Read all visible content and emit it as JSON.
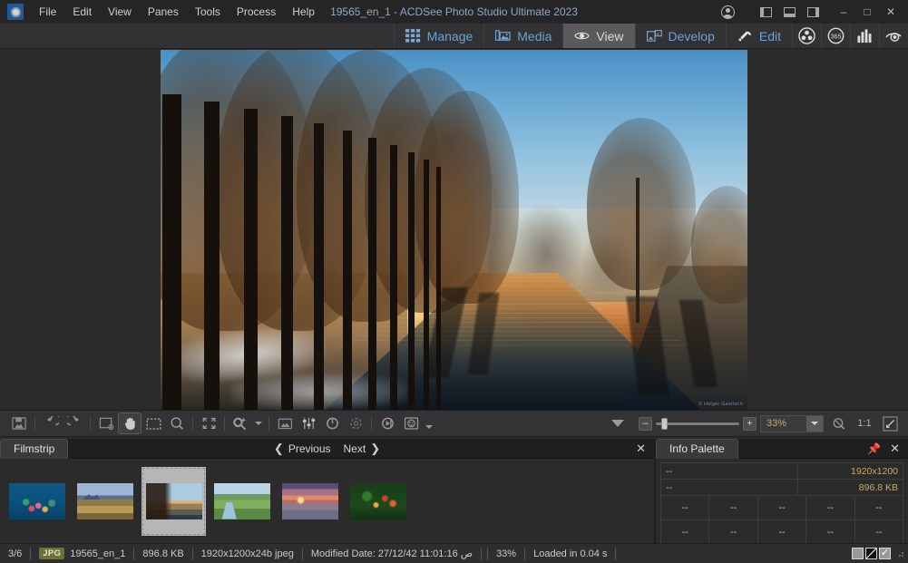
{
  "window": {
    "title": "19565_en_1 - ACDSee Photo Studio Ultimate 2023",
    "app_icon": "acdsee-logo-icon",
    "minimize": "–",
    "maximize": "□",
    "close": "✕"
  },
  "menu": {
    "items": [
      {
        "label": "File"
      },
      {
        "label": "Edit"
      },
      {
        "label": "View"
      },
      {
        "label": "Panes"
      },
      {
        "label": "Tools"
      },
      {
        "label": "Process"
      },
      {
        "label": "Help"
      }
    ]
  },
  "title_right": {
    "account_icon": "person-icon",
    "pane_left_icon": "pane-left-icon",
    "pane_bottom_icon": "pane-bottom-icon",
    "pane_right_icon": "pane-right-icon"
  },
  "modebar": {
    "tabs": [
      {
        "label": "Manage",
        "icon": "grid-icon",
        "active": false
      },
      {
        "label": "Media",
        "icon": "media-stack-icon",
        "active": false
      },
      {
        "label": "View",
        "icon": "eye-icon",
        "active": true
      },
      {
        "label": "Develop",
        "icon": "develop-icon",
        "active": false
      },
      {
        "label": "Edit",
        "icon": "brush-pencil-icon",
        "active": false
      }
    ],
    "extra_icons": [
      {
        "name": "people-icon"
      },
      {
        "name": "365-icon",
        "label": "365"
      },
      {
        "name": "histogram-icon"
      },
      {
        "name": "eye-dropper-icon"
      }
    ]
  },
  "viewer": {
    "image_alt": "Frozen canal lined with bare trees at sunrise",
    "watermark": "© Holger Gaertsch"
  },
  "view_toolbar": {
    "tools": [
      {
        "name": "save-image-icon"
      },
      {
        "name": "rotate-left-icon"
      },
      {
        "name": "rotate-right-icon"
      },
      {
        "name": "fit-image-icon"
      },
      {
        "name": "pan-hand-icon",
        "selected": true
      },
      {
        "name": "select-region-icon"
      },
      {
        "name": "magnifier-icon"
      },
      {
        "name": "fullscreen-icon"
      },
      {
        "name": "auto-edit-icon"
      },
      {
        "name": "auto-edit-dropdown-icon"
      },
      {
        "name": "filmstrip-toggle-icon"
      },
      {
        "name": "adjust-sliders-icon"
      },
      {
        "name": "exposure-dial-icon"
      },
      {
        "name": "refresh-icon"
      },
      {
        "name": "slideshow-play-icon"
      },
      {
        "name": "face-detect-icon"
      },
      {
        "name": "more-dropdown-icon"
      }
    ],
    "zoom": {
      "collapse_icon": "collapse-caret-icon",
      "minus": "–",
      "plus": "+",
      "value": "33%",
      "dropdown_icon": "chevron-down-icon",
      "zoom_reset_icon": "zoom-reset-icon",
      "one_to_one": "1:1",
      "fit_icon": "fit-to-window-icon"
    }
  },
  "filmstrip": {
    "tab_label": "Filmstrip",
    "previous_label": "Previous",
    "next_label": "Next",
    "prev_icon": "chevron-left-icon",
    "next_icon": "chevron-right-icon",
    "close_icon": "close-icon",
    "thumbnails": [
      {
        "name": "thumb-coral-reef",
        "selected": false
      },
      {
        "name": "thumb-mountain-field",
        "selected": false
      },
      {
        "name": "thumb-frozen-canal",
        "selected": true
      },
      {
        "name": "thumb-green-meadow",
        "selected": false
      },
      {
        "name": "thumb-sunset-sea",
        "selected": false
      },
      {
        "name": "thumb-autumn-berries",
        "selected": false
      }
    ]
  },
  "info_palette": {
    "tab_label": "Info Palette",
    "pin_icon": "pin-icon",
    "close_icon": "close-icon",
    "row1_left": "--",
    "row1_right": "1920x1200",
    "row2_left": "--",
    "row2_right": "896.8 KB",
    "grid_row_a": [
      "--",
      "--",
      "--",
      "--",
      "--"
    ],
    "grid_row_b": [
      "--",
      "--",
      "--",
      "--",
      "--"
    ],
    "footer": "--"
  },
  "statusbar": {
    "index": "3/6",
    "format_badge": "JPG",
    "filename": "19565_en_1",
    "filesize": "896.8 KB",
    "dimensions": "1920x1200x24b jpeg",
    "modified": "Modified Date: 27/12/42 11:01:16 ص",
    "zoom": "33%",
    "load_time": "Loaded in 0.04 s",
    "icons": [
      {
        "name": "color-swatch-icon"
      },
      {
        "name": "contrast-icon"
      },
      {
        "name": "checkmark-icon"
      }
    ],
    "resize_grip": "resize-grip-icon"
  }
}
